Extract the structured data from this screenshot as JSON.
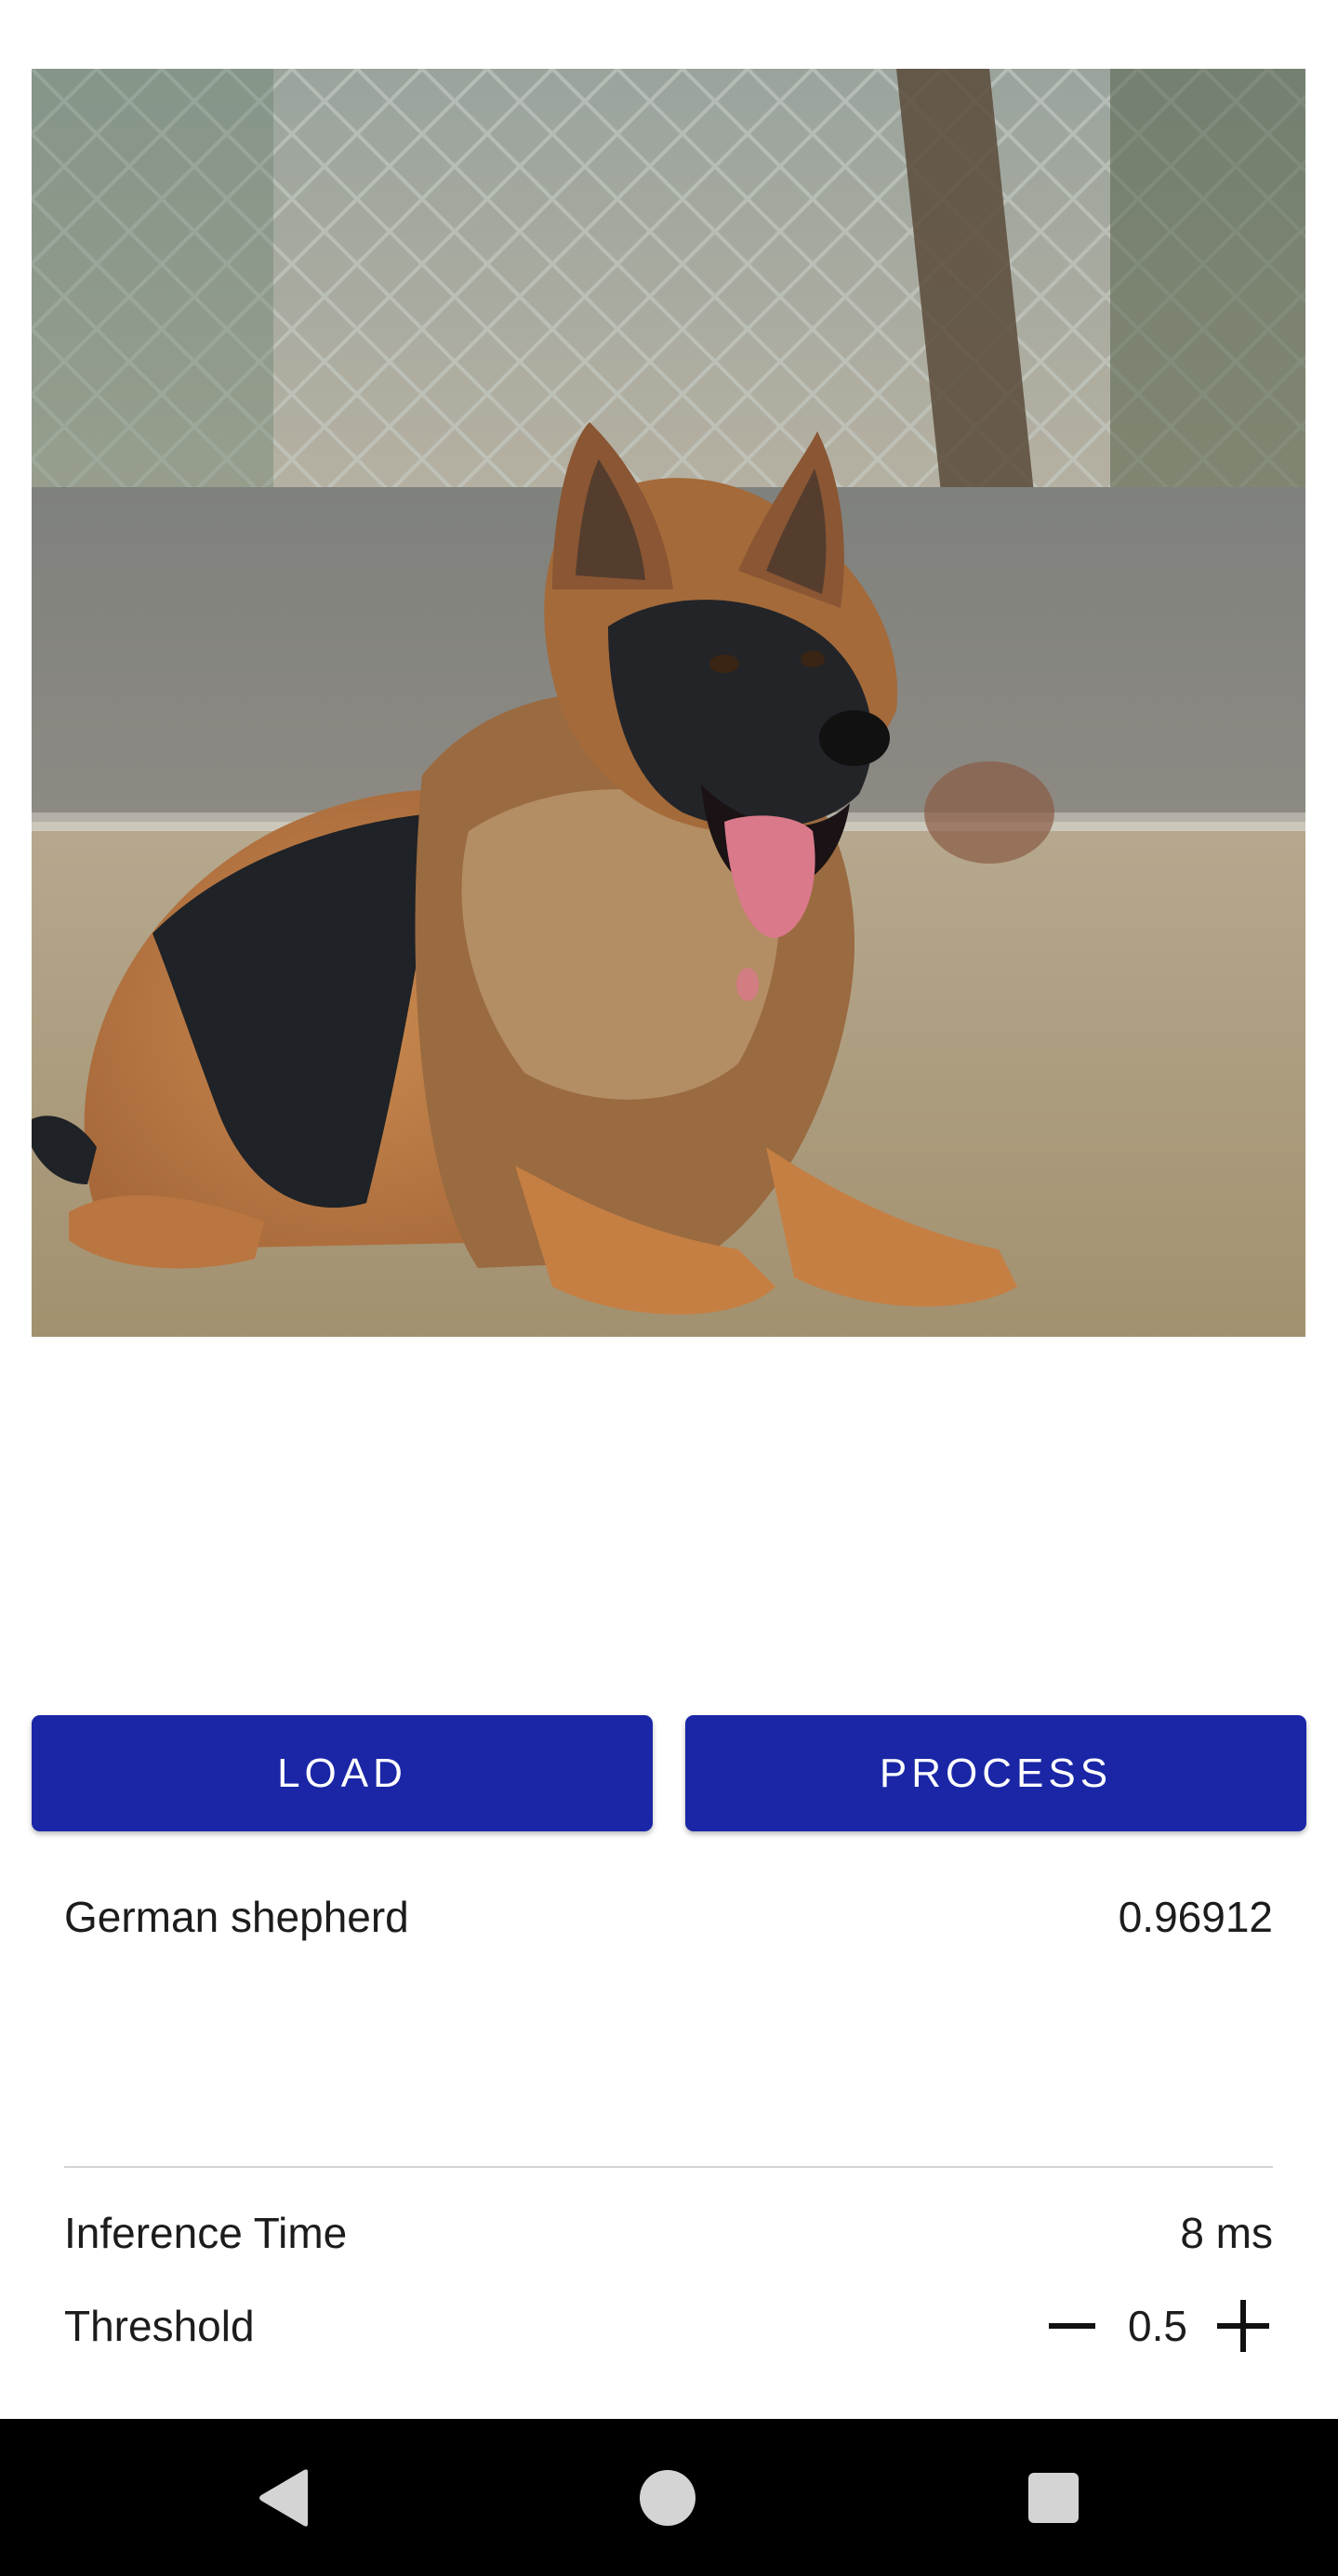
{
  "image": {
    "subject": "German shepherd dog lying on grass"
  },
  "buttons": {
    "load_label": "LOAD",
    "process_label": "PROCESS"
  },
  "result": {
    "label": "German shepherd",
    "score": "0.96912"
  },
  "stats": {
    "inference_label": "Inference Time",
    "inference_value": "8 ms",
    "threshold_label": "Threshold",
    "threshold_value": "0.5"
  },
  "icons": {
    "decrease": "minus-icon",
    "increase": "plus-icon",
    "back": "back-triangle-icon",
    "home": "home-circle-icon",
    "recents": "recents-square-icon"
  },
  "colors": {
    "accent": "#1a26a6",
    "navbar": "#000000",
    "divider": "#d4d4d4"
  }
}
